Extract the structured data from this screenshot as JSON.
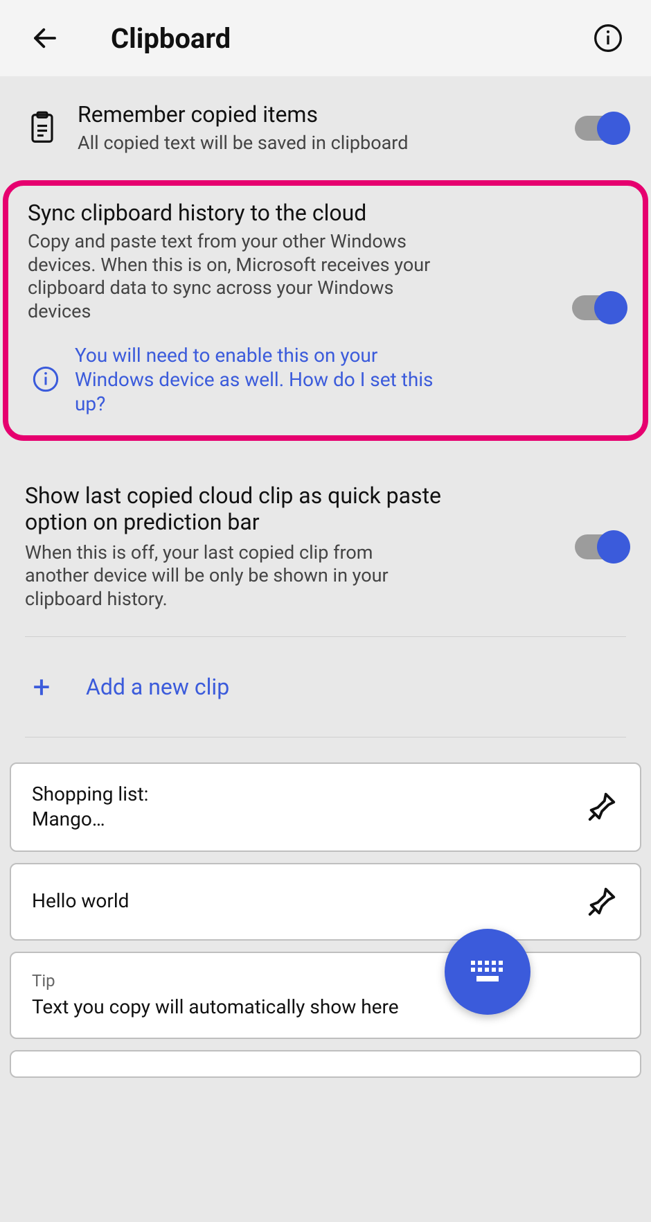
{
  "header": {
    "title": "Clipboard"
  },
  "settings": {
    "remember": {
      "title": "Remember copied items",
      "subtitle": "All copied text will be saved in clipboard",
      "on": true
    },
    "sync": {
      "title": "Sync clipboard history to the cloud",
      "description": "Copy and paste text from your other Windows devices. When this is on, Microsoft receives your clipboard data to sync across your Windows devices",
      "hint": "You will need to enable this on your Windows device as well. How do I set this up?",
      "on": true
    },
    "quickPaste": {
      "title": "Show last copied cloud clip as quick paste option on prediction bar",
      "subtitle": "When this is off, your last copied clip from another device will be only be shown in your clipboard history.",
      "on": true
    }
  },
  "addClip": {
    "label": "Add a new clip"
  },
  "clips": [
    {
      "text": "Shopping list:\nMango…"
    },
    {
      "text": "Hello world"
    }
  ],
  "tip": {
    "label": "Tip",
    "text": "Text you copy will automatically show here"
  },
  "colors": {
    "accent": "#3b5bdb",
    "highlight": "#e6006f"
  }
}
